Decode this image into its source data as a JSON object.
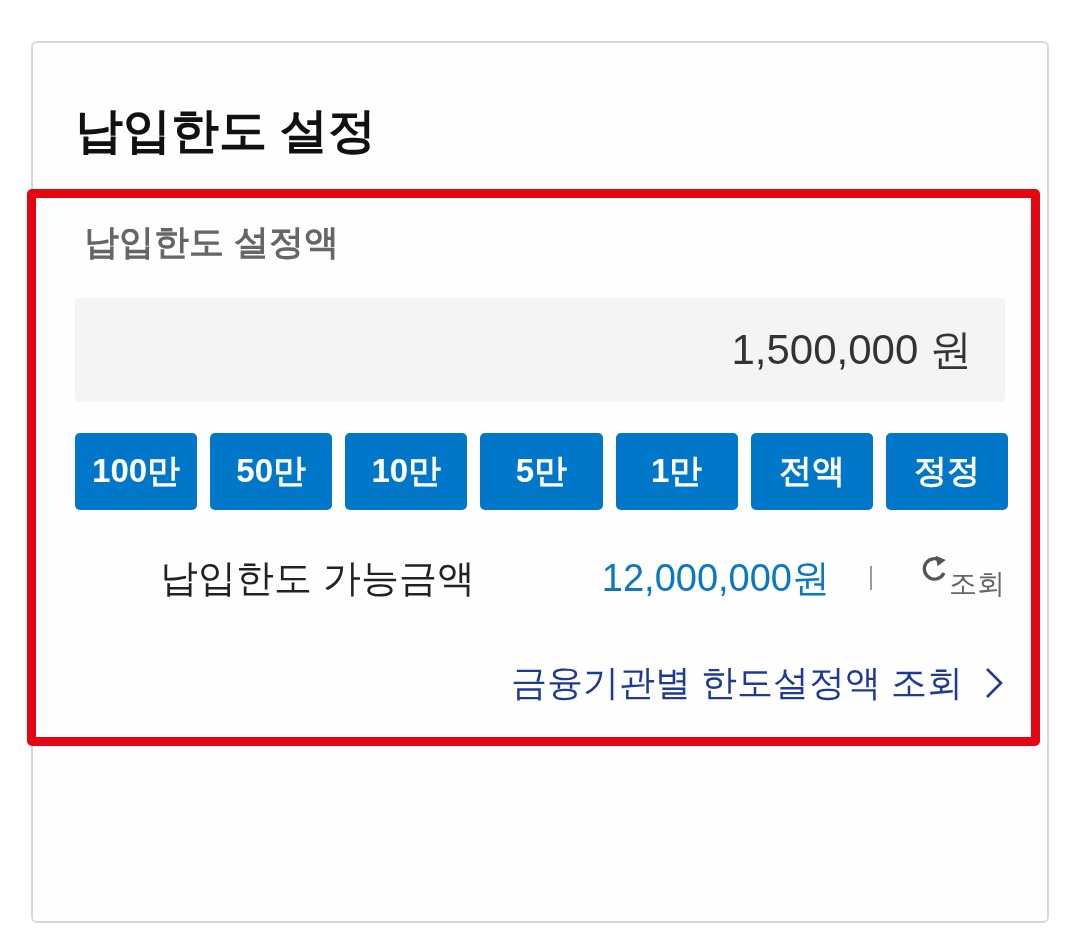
{
  "card": {
    "title": "납입한도 설정"
  },
  "limit_setting": {
    "label": "납입한도 설정액",
    "amount_field": {
      "value": "1,500,000 원"
    },
    "amount_buttons": [
      "100만",
      "50만",
      "10만",
      "5만",
      "1만",
      "전액",
      "정정"
    ],
    "available": {
      "label": "납입한도 가능금액",
      "amount": "12,000,000원",
      "refresh_label": "조회"
    },
    "link": "금융기관별 한도설정액 조회"
  }
}
